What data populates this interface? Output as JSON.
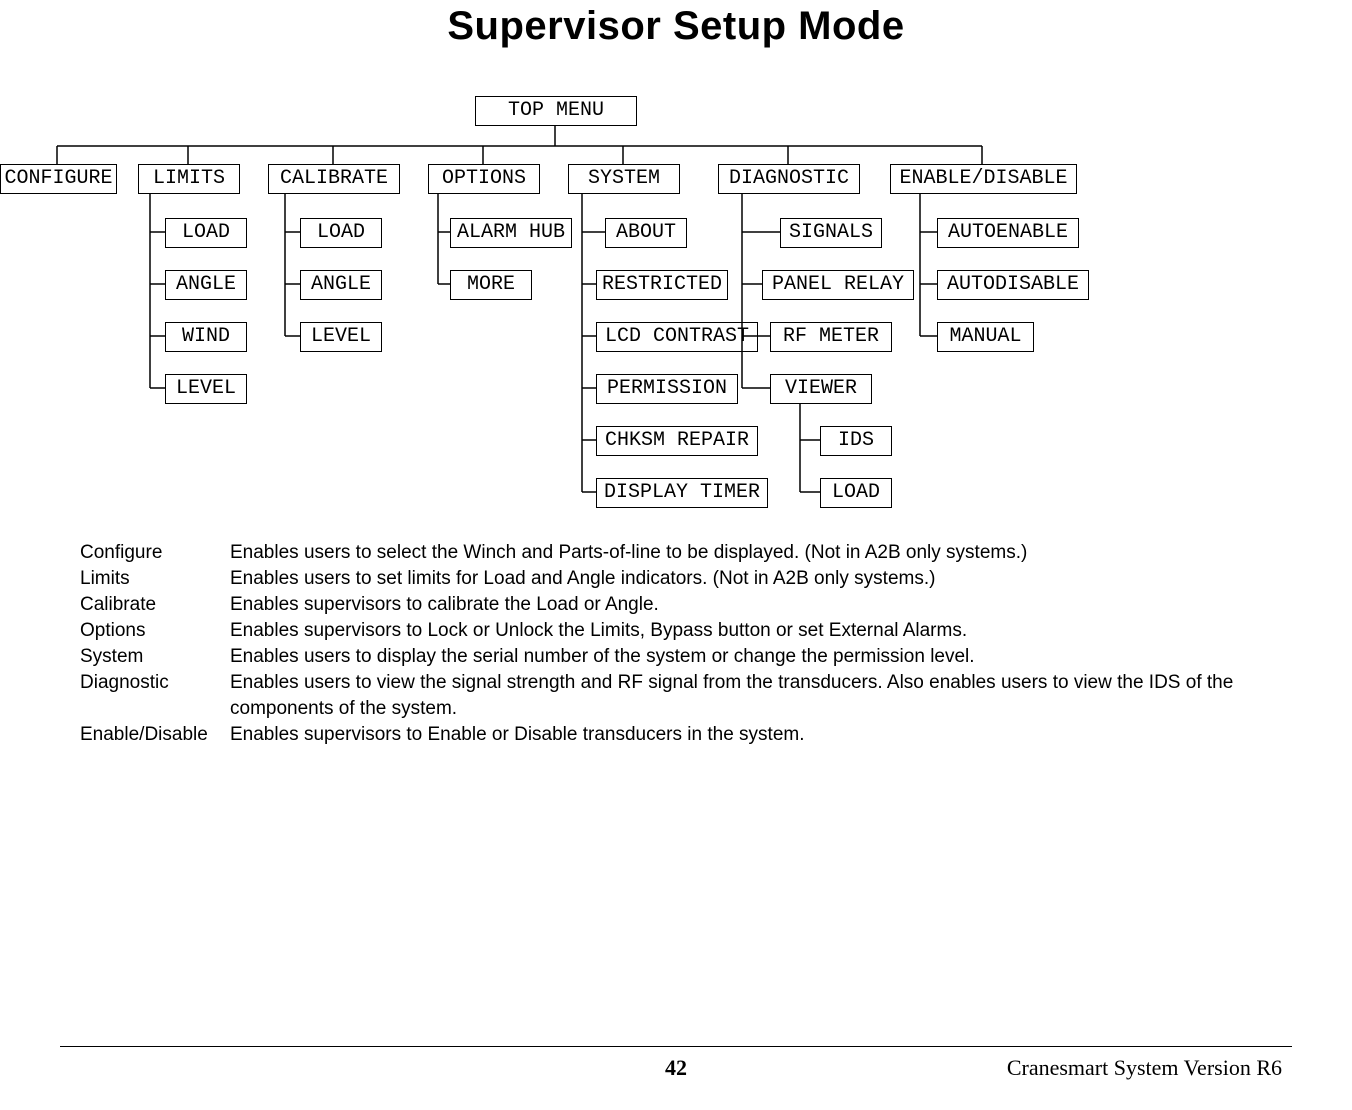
{
  "title": "Supervisor Setup Mode",
  "tree": {
    "top": "TOP MENU",
    "cols": {
      "configure": {
        "head": "CONFIGURE",
        "children": []
      },
      "limits": {
        "head": "LIMITS",
        "children": [
          "LOAD",
          "ANGLE",
          "WIND",
          "LEVEL"
        ]
      },
      "calibrate": {
        "head": "CALIBRATE",
        "children": [
          "LOAD",
          "ANGLE",
          "LEVEL"
        ]
      },
      "options": {
        "head": "OPTIONS",
        "children": [
          "ALARM HUB",
          "MORE"
        ]
      },
      "system": {
        "head": "SYSTEM",
        "children": [
          "ABOUT",
          "RESTRICTED",
          "LCD CONTRAST",
          "PERMISSION",
          "CHKSM REPAIR",
          "DISPLAY TIMER"
        ]
      },
      "diagnostic": {
        "head": "DIAGNOSTIC",
        "children": [
          "SIGNALS",
          "PANEL RELAY",
          "RF METER",
          "VIEWER"
        ],
        "viewer_children": [
          "IDS",
          "LOAD"
        ]
      },
      "enable": {
        "head": "ENABLE/DISABLE",
        "children": [
          "AUTOENABLE",
          "AUTODISABLE",
          "MANUAL"
        ]
      }
    }
  },
  "definitions": [
    {
      "term": "Configure",
      "desc": "Enables users to select the Winch and Parts-of-line to be displayed. (Not in A2B only systems.)"
    },
    {
      "term": "Limits",
      "desc": "Enables users to set limits for Load and Angle indicators.  (Not in A2B only systems.)"
    },
    {
      "term": "Calibrate",
      "desc": "Enables supervisors to calibrate the Load or Angle."
    },
    {
      "term": "Options",
      "desc": "Enables supervisors to Lock or Unlock the Limits, Bypass button or set External Alarms."
    },
    {
      "term": "System",
      "desc": "Enables users to display the serial number of the system or change the permission level."
    },
    {
      "term": "Diagnostic",
      "desc": "Enables users to view the signal strength and RF signal from the transducers.  Also enables users to view the IDS of the components of the system."
    },
    {
      "term": "Enable/Disable",
      "desc": "Enables supervisors to Enable or Disable transducers in the system."
    }
  ],
  "footer": {
    "page": "42",
    "version": "Cranesmart System Version R6"
  }
}
